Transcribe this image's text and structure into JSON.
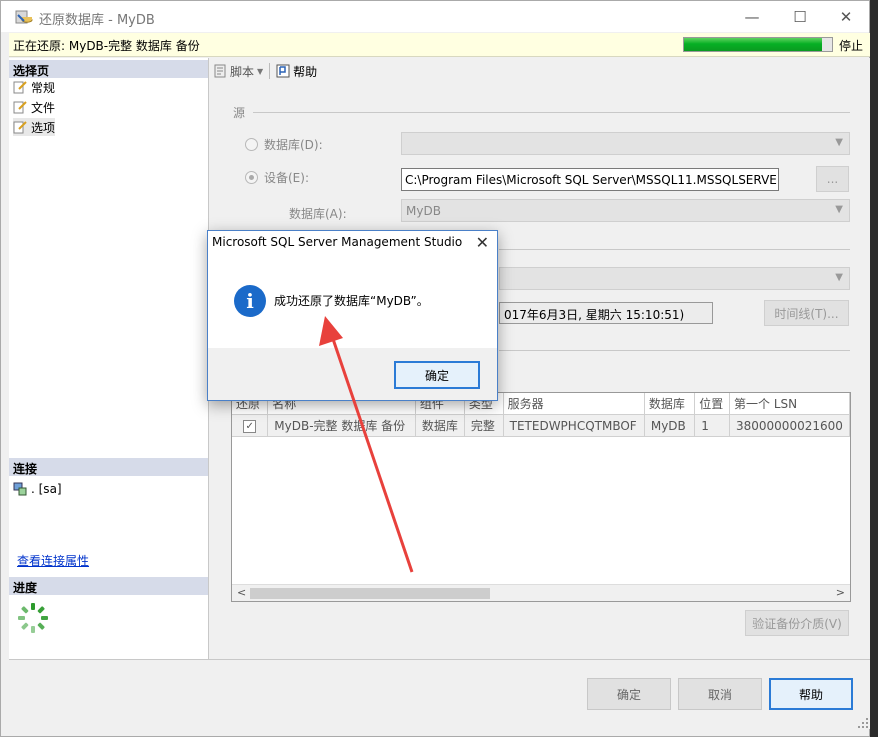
{
  "window": {
    "title": "还原数据库 - MyDB",
    "controls": {
      "minimize": "—",
      "maximize": "☐",
      "close": "✕"
    }
  },
  "status": {
    "text": "正在还原: MyDB-完整 数据库 备份",
    "progress": 0.93,
    "stop_label": "停止"
  },
  "left": {
    "select_page_header": "选择页",
    "pages": [
      "常规",
      "文件",
      "选项"
    ],
    "connection_header": "连接",
    "connection_value": ". [sa]",
    "view_conn_props": "查看连接属性",
    "progress_header": "进度"
  },
  "toolbar": {
    "script": "脚本",
    "help": "帮助"
  },
  "source": {
    "label": "源",
    "database_radio": "数据库(D):",
    "device_radio": "设备(E):",
    "device_path": "C:\\Program Files\\Microsoft SQL Server\\MSSQL11.MSSQLSERVER",
    "browse": "...",
    "database_label": "数据库(A):",
    "database_value": "MyDB"
  },
  "target": {
    "date_text": "017年6月3日, 星期六 15:10:51)",
    "timeline_btn": "时间线(T)..."
  },
  "grid": {
    "headers": [
      "还原",
      "名称",
      "组件",
      "类型",
      "服务器",
      "数据库",
      "位置",
      "第一个 LSN"
    ],
    "rows": [
      {
        "checked": "✓",
        "name": "MyDB-完整 数据库 备份",
        "component": "数据库",
        "type": "完整",
        "server": "TETEDWPHCQTMBOF",
        "database": "MyDB",
        "position": "1",
        "lsn": "38000000021600"
      }
    ]
  },
  "verify_btn": "验证备份介质(V)",
  "buttons": {
    "ok": "确定",
    "cancel": "取消",
    "help": "帮助"
  },
  "dialog": {
    "title": "Microsoft SQL Server Management Studio",
    "close": "✕",
    "icon": "i",
    "message": "成功还原了数据库“MyDB”。",
    "ok": "确定"
  },
  "colors": {
    "progress_fill": "#06b025",
    "accent": "#2b7bd6",
    "annotation_arrow": "#e8413c"
  }
}
